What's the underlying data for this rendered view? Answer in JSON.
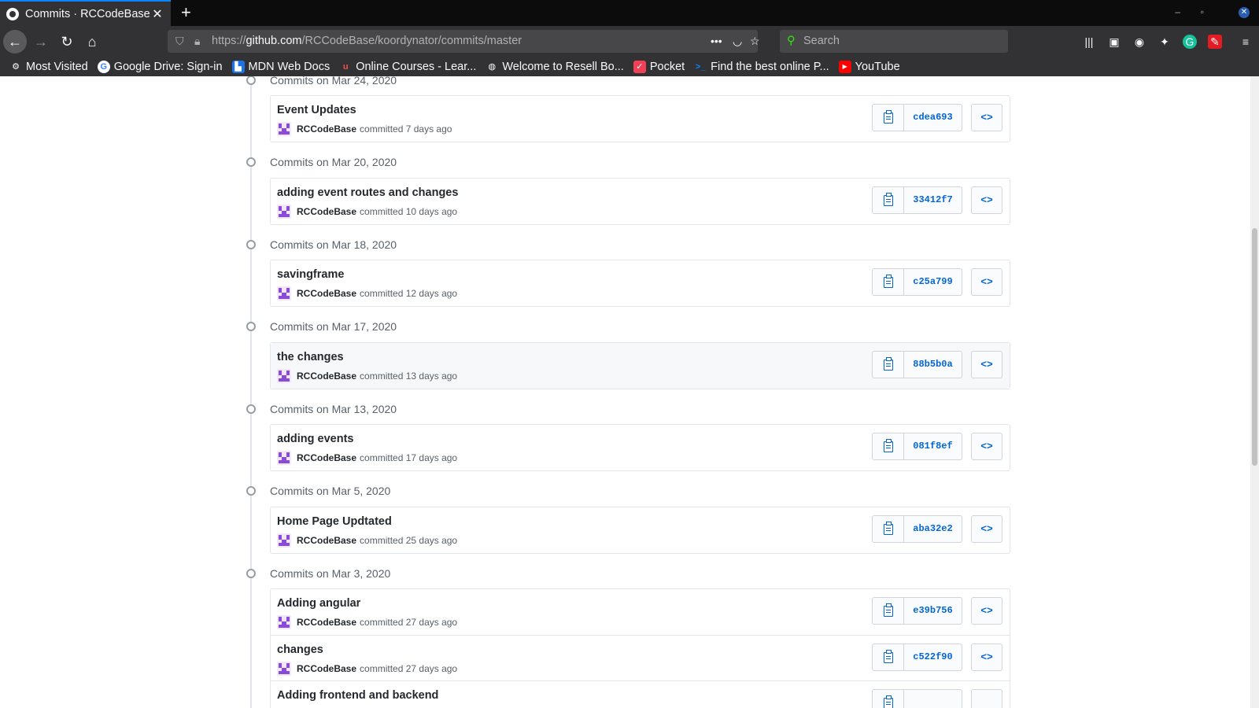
{
  "browser": {
    "tab_title": "Commits · RCCodeBase/koordynator",
    "tab_close": "✕",
    "new_tab": "+",
    "url_prefix": "https://",
    "url_host": "github.com",
    "url_path": "/RCCodeBase/koordynator/commits/master",
    "search_placeholder": "Search",
    "more_icon": "•••",
    "window_controls": [
      "–",
      "▫",
      "✕"
    ]
  },
  "bookmarks": [
    {
      "label": "Most Visited",
      "icon": "gear-icon",
      "color": "#f9f9fa"
    },
    {
      "label": "Google Drive: Sign-in",
      "icon": "google-icon",
      "color": "#ffffff"
    },
    {
      "label": "MDN Web Docs",
      "icon": "mdn-icon",
      "color": "#1a73e8"
    },
    {
      "label": "Online Courses - Lear...",
      "icon": "udemy-icon",
      "color": "#ec5252"
    },
    {
      "label": "Welcome to Resell Bo...",
      "icon": "globe-icon",
      "color": "#b1b1b3"
    },
    {
      "label": "Pocket",
      "icon": "pocket-icon",
      "color": "#ef4056"
    },
    {
      "label": "Find the best online P...",
      "icon": "terminal-icon",
      "color": "#0a84ff"
    },
    {
      "label": "YouTube",
      "icon": "youtube-icon",
      "color": "#ff0000"
    }
  ],
  "groups": [
    {
      "date": "Commits on Mar 24, 2020",
      "commits": [
        {
          "title": "Event Updates",
          "author": "RCCodeBase",
          "time": "committed 7 days ago",
          "sha": "cdea693"
        }
      ]
    },
    {
      "date": "Commits on Mar 20, 2020",
      "commits": [
        {
          "title": "adding event routes and changes",
          "author": "RCCodeBase",
          "time": "committed 10 days ago",
          "sha": "33412f7"
        }
      ]
    },
    {
      "date": "Commits on Mar 18, 2020",
      "commits": [
        {
          "title": "savingframe",
          "author": "RCCodeBase",
          "time": "committed 12 days ago",
          "sha": "c25a799"
        }
      ]
    },
    {
      "date": "Commits on Mar 17, 2020",
      "commits": [
        {
          "title": "the changes",
          "author": "RCCodeBase",
          "time": "committed 13 days ago",
          "sha": "88b5b0a"
        }
      ]
    },
    {
      "date": "Commits on Mar 13, 2020",
      "commits": [
        {
          "title": "adding events",
          "author": "RCCodeBase",
          "time": "committed 17 days ago",
          "sha": "081f8ef"
        }
      ]
    },
    {
      "date": "Commits on Mar 5, 2020",
      "commits": [
        {
          "title": "Home Page Updtated",
          "author": "RCCodeBase",
          "time": "committed 25 days ago",
          "sha": "aba32e2"
        }
      ]
    },
    {
      "date": "Commits on Mar 3, 2020",
      "commits": [
        {
          "title": "Adding angular",
          "author": "RCCodeBase",
          "time": "committed 27 days ago",
          "sha": "e39b756"
        },
        {
          "title": "changes",
          "author": "RCCodeBase",
          "time": "committed 27 days ago",
          "sha": "c522f90"
        },
        {
          "title": "Adding frontend and backend",
          "author": "",
          "time": "",
          "sha": ""
        }
      ]
    }
  ],
  "browse_label": "<>",
  "colors": {
    "link": "#0366d6",
    "timeline": "#e1e4e8",
    "accent": "#0a84ff"
  }
}
